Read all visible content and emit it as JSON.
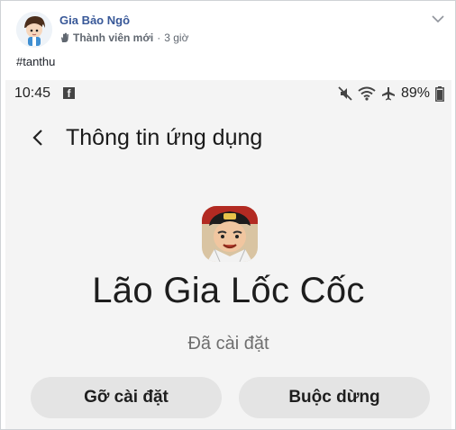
{
  "post": {
    "author": "Gia Bảo Ngô",
    "badge": "Thành viên mới",
    "separator": "·",
    "time": "3 giờ",
    "hashtag": "#tanthu"
  },
  "phone": {
    "status_bar": {
      "time": "10:45",
      "notification_icon": "facebook-icon",
      "battery": "89%",
      "icons": [
        "mute-icon",
        "wifi-icon",
        "airplane-icon",
        "battery-icon"
      ]
    },
    "app_bar": {
      "title": "Thông tin ứng dụng"
    },
    "app": {
      "name": "Lão Gia Lốc Cốc",
      "status": "Đã cài đặt"
    },
    "buttons": {
      "uninstall": "Gỡ cài đặt",
      "force_stop": "Buộc dừng"
    }
  },
  "colors": {
    "author_link": "#385898",
    "phone_background": "#f4f4f4",
    "button_background": "#e4e4e4"
  }
}
